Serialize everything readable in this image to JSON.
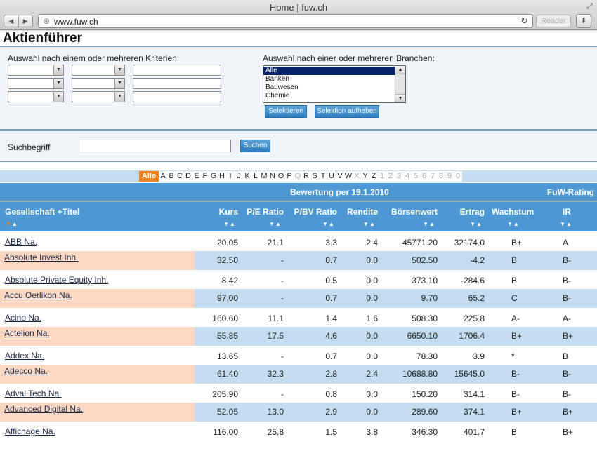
{
  "browser": {
    "title": "Home | fuw.ch",
    "url": "www.fuw.ch",
    "reader_label": "Reader",
    "back_icon": "◀",
    "forward_icon": "▶"
  },
  "page": {
    "title": "Aktienführer"
  },
  "criteria": {
    "label": "Auswahl nach einem oder mehreren Kriterien:"
  },
  "branches": {
    "label": "Auswahl nach einer oder mehreren Branchen:",
    "options": [
      "Alle",
      "Banken",
      "Bauwesen",
      "Chemie"
    ],
    "selected_index": 0,
    "select_button": "Selektieren",
    "clear_button": "Selektion aufheben"
  },
  "search": {
    "label": "Suchbegriff",
    "value": "",
    "button": "Suchen"
  },
  "alphabet": {
    "active": "Alle",
    "letters": [
      "A",
      "B",
      "C",
      "D",
      "E",
      "F",
      "G",
      "H",
      "I",
      "J",
      "K",
      "L",
      "M",
      "N",
      "O",
      "P",
      "Q",
      "R",
      "S",
      "T",
      "U",
      "V",
      "W",
      "X",
      "Y",
      "Z",
      "1",
      "2",
      "3",
      "4",
      "5",
      "6",
      "7",
      "8",
      "9",
      "0"
    ],
    "disabled": [
      "Q",
      "X",
      "1",
      "2",
      "3",
      "4",
      "5",
      "6",
      "7",
      "8",
      "9",
      "0"
    ]
  },
  "table": {
    "group_header": "Bewertung per 19.1.2010",
    "rating_header": "FuW-Rating",
    "columns": {
      "name": "Gesellschaft +Titel",
      "kurs": "Kurs",
      "pe": "P/E Ratio",
      "pbv": "P/BV Ratio",
      "rendite": "Rendite",
      "boersenwert": "Börsenwert",
      "ertrag": "Ertrag",
      "wachstum": "Wachstum",
      "ir": "IR"
    },
    "sort_down_icon": "▼",
    "sort_up_icon": "▲",
    "rows": [
      {
        "name": "ABB Na.",
        "kurs": "20.05",
        "pe": "21.1",
        "pbv": "3.3",
        "rendite": "2.4",
        "boersenwert": "45771.20",
        "ertrag": "32174.0",
        "wachstum": "B+",
        "ir": "A"
      },
      {
        "name": "Absolute Invest Inh.",
        "kurs": "32.50",
        "pe": "-",
        "pbv": "0.7",
        "rendite": "0.0",
        "boersenwert": "502.50",
        "ertrag": "-4.2",
        "wachstum": "B",
        "ir": "B-"
      },
      {
        "name": "Absolute Private Equity Inh.",
        "kurs": "8.42",
        "pe": "-",
        "pbv": "0.5",
        "rendite": "0.0",
        "boersenwert": "373.10",
        "ertrag": "-284.6",
        "wachstum": "B",
        "ir": "B-"
      },
      {
        "name": "Accu Oerlikon Na.",
        "kurs": "97.00",
        "pe": "-",
        "pbv": "0.7",
        "rendite": "0.0",
        "boersenwert": "9.70",
        "ertrag": "65.2",
        "wachstum": "C",
        "ir": "B-"
      },
      {
        "name": "Acino Na.",
        "kurs": "160.60",
        "pe": "11.1",
        "pbv": "1.4",
        "rendite": "1.6",
        "boersenwert": "508.30",
        "ertrag": "225.8",
        "wachstum": "A-",
        "ir": "A-"
      },
      {
        "name": "Actelion Na.",
        "kurs": "55.85",
        "pe": "17.5",
        "pbv": "4.6",
        "rendite": "0.0",
        "boersenwert": "6650.10",
        "ertrag": "1706.4",
        "wachstum": "B+",
        "ir": "B+"
      },
      {
        "name": "Addex Na.",
        "kurs": "13.65",
        "pe": "-",
        "pbv": "0.7",
        "rendite": "0.0",
        "boersenwert": "78.30",
        "ertrag": "3.9",
        "wachstum": "*",
        "ir": "B"
      },
      {
        "name": "Adecco Na.",
        "kurs": "61.40",
        "pe": "32.3",
        "pbv": "2.8",
        "rendite": "2.4",
        "boersenwert": "10688.80",
        "ertrag": "15645.0",
        "wachstum": "B-",
        "ir": "B-"
      },
      {
        "name": "Adval Tech Na.",
        "kurs": "205.90",
        "pe": "-",
        "pbv": "0.8",
        "rendite": "0.0",
        "boersenwert": "150.20",
        "ertrag": "314.1",
        "wachstum": "B-",
        "ir": "B-"
      },
      {
        "name": "Advanced Digital Na.",
        "kurs": "52.05",
        "pe": "13.0",
        "pbv": "2.9",
        "rendite": "0.0",
        "boersenwert": "289.60",
        "ertrag": "374.1",
        "wachstum": "B+",
        "ir": "B+"
      },
      {
        "name": "Affichage Na.",
        "kurs": "116.00",
        "pe": "25.8",
        "pbv": "1.5",
        "rendite": "3.8",
        "boersenwert": "346.30",
        "ertrag": "401.7",
        "wachstum": "B",
        "ir": "B+"
      }
    ]
  }
}
